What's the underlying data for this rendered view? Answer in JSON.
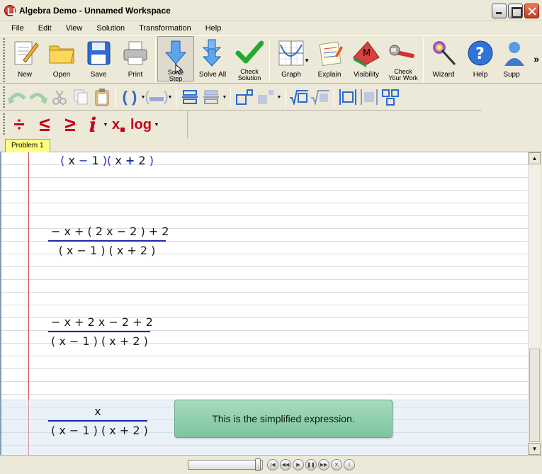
{
  "window": {
    "title": "Algebra Demo - Unnamed Workspace"
  },
  "menu": [
    "File",
    "Edit",
    "View",
    "Solution",
    "Transformation",
    "Help"
  ],
  "toolbar": {
    "new": "New",
    "open": "Open",
    "save": "Save",
    "print": "Print",
    "solve_step_line1": "Solve",
    "solve_step_line2": "Step",
    "solve_all": "Solve All",
    "check_solution_line1": "Check",
    "check_solution_line2": "Solution",
    "graph": "Graph",
    "explain": "Explain",
    "visibility": "Visibility",
    "check_work_line1": "Check",
    "check_work_line2": "Your Work",
    "wizard": "Wizard",
    "help": "Help",
    "support": "Supp",
    "more": "»"
  },
  "toolbar3": {
    "divide": "÷",
    "le": "≤",
    "ge": "≥",
    "info": "i",
    "subscript": "x",
    "log": "log"
  },
  "tabs": [
    "Problem 1"
  ],
  "math": {
    "step1_den": [
      "(",
      "x",
      "−",
      "1",
      ")",
      "(",
      "x",
      "+",
      "2",
      ")"
    ],
    "step2_num": "− x + ( 2 x − 2 ) + 2",
    "step2_den": "( x − 1 ) ( x + 2 )",
    "step3_num": "− x + 2 x − 2 + 2",
    "step3_den": "( x − 1 ) ( x + 2 )",
    "step4_num": "x",
    "step4_den": "( x − 1 ) ( x + 2 )"
  },
  "tooltip": "This is the simplified expression."
}
